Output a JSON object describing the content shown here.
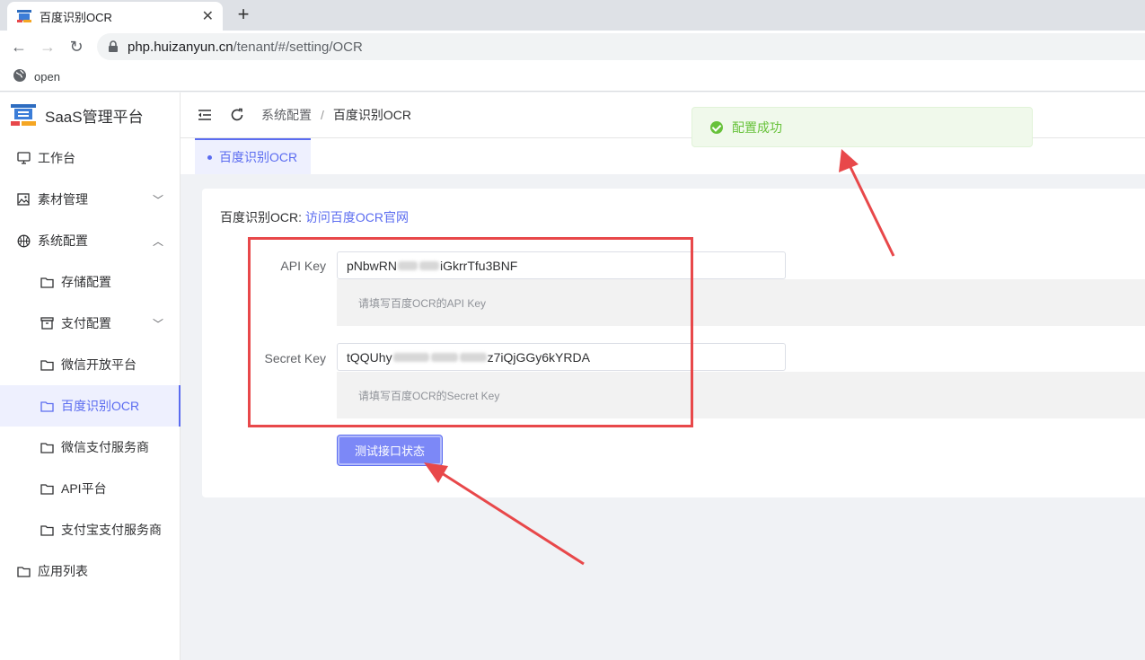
{
  "browser": {
    "tab_title": "百度识别OCR",
    "url_host": "php.huizanyun.cn",
    "url_path": "/tenant/#/setting/OCR",
    "bookmark": "open"
  },
  "sidebar": {
    "brand": "SaaS管理平台",
    "items": [
      {
        "label": "工作台",
        "icon": "monitor-icon"
      },
      {
        "label": "素材管理",
        "icon": "image-icon"
      },
      {
        "label": "系统配置",
        "icon": "basketball-icon"
      },
      {
        "label": "存储配置",
        "icon": "folder-icon"
      },
      {
        "label": "支付配置",
        "icon": "box-icon"
      },
      {
        "label": "微信开放平台",
        "icon": "folder-icon"
      },
      {
        "label": "百度识别OCR",
        "icon": "folder-icon"
      },
      {
        "label": "微信支付服务商",
        "icon": "folder-icon"
      },
      {
        "label": "API平台",
        "icon": "folder-icon"
      },
      {
        "label": "支付宝支付服务商",
        "icon": "folder-icon"
      },
      {
        "label": "应用列表",
        "icon": "folder-icon"
      }
    ]
  },
  "header": {
    "breadcrumb": [
      "系统配置",
      "/",
      "百度识别OCR"
    ]
  },
  "tags": {
    "active": "百度识别OCR"
  },
  "form": {
    "intro_prefix": "百度识别OCR: ",
    "intro_link": "访问百度OCR官网",
    "api_key_label": "API Key",
    "api_key_value_start": "pNbwRN",
    "api_key_value_end": "iGkrrTfu3BNF",
    "api_key_hint": "请填写百度OCR的API Key",
    "secret_key_label": "Secret Key",
    "secret_key_value_start": "tQQUhy",
    "secret_key_value_end": "z7iQjGGy6kYRDA",
    "secret_key_hint": "请填写百度OCR的Secret Key",
    "test_button": "测试接口状态"
  },
  "toast": {
    "message": "配置成功"
  },
  "colors": {
    "accent": "#5b6cf0",
    "success": "#67c23a",
    "annotation": "#e8484a"
  }
}
